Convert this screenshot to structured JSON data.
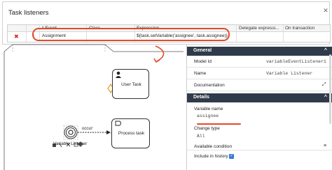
{
  "dialog": {
    "title": "Task listeners",
    "close": "✕",
    "columns": [
      "* Event",
      "Class",
      "Expression",
      "Delegate expressi...",
      "On transaction"
    ],
    "rows": [
      {
        "event": "Assignment",
        "class": "",
        "expression": "${task.setVariable('assignee', task.assignee)}",
        "delegate_expression": "",
        "on_transaction": ""
      }
    ]
  },
  "diagram": {
    "user_task_label": "User Task",
    "process_task_label": "Process task",
    "event_label": "Variable Listener",
    "occur_label": "occur:"
  },
  "properties": {
    "general_header": "General",
    "model_id_label": "Model Id",
    "model_id_value": "variableEventListener1",
    "name_label": "Name",
    "name_value": "Variable Listener",
    "documentation_label": "Documentation",
    "details_header": "Details",
    "variable_name_label": "Variable name",
    "variable_name_value": "assignee",
    "change_type_label": "Change type",
    "change_type_value": "All",
    "available_condition_label": "Available condition",
    "include_history_label": "Include in history",
    "include_history_checked": "✓"
  },
  "colors": {
    "annotation": "#e2492b",
    "panel_header": "#2f3b4a",
    "checkbox": "#3a78d6"
  }
}
